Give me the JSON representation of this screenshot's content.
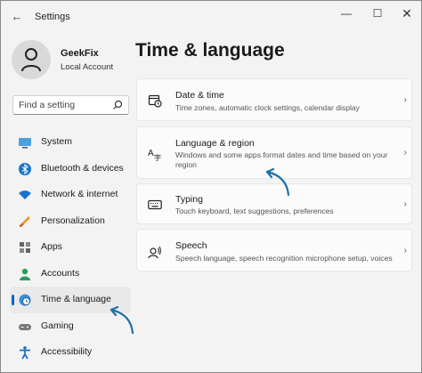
{
  "window": {
    "title": "Settings",
    "back_icon": "back-arrow-icon",
    "controls": [
      "minimize-icon",
      "maximize-icon",
      "close-icon"
    ]
  },
  "profile": {
    "name": "GeekFix",
    "account": "Local Account",
    "avatar_icon": "person-icon"
  },
  "search": {
    "placeholder": "Find a setting",
    "icon": "search-icon"
  },
  "nav": {
    "selected": "Time & language",
    "items": [
      {
        "label": "System",
        "icon": "display-icon"
      },
      {
        "label": "Bluetooth & devices",
        "icon": "bluetooth-icon"
      },
      {
        "label": "Network & internet",
        "icon": "wifi-icon"
      },
      {
        "label": "Personalization",
        "icon": "brush-icon"
      },
      {
        "label": "Apps",
        "icon": "apps-icon"
      },
      {
        "label": "Accounts",
        "icon": "accounts-icon"
      },
      {
        "label": "Time & language",
        "icon": "globe-clock-icon"
      },
      {
        "label": "Gaming",
        "icon": "gamepad-icon"
      },
      {
        "label": "Accessibility",
        "icon": "accessibility-icon"
      }
    ]
  },
  "page": {
    "title": "Time & language",
    "cards": [
      {
        "title": "Date & time",
        "desc": "Time zones, automatic clock settings, calendar display",
        "icon": "calendar-clock-icon"
      },
      {
        "title": "Language & region",
        "desc": "Windows and some apps format dates and time based on your region",
        "icon": "language-icon"
      },
      {
        "title": "Typing",
        "desc": "Touch keyboard, text suggestions, preferences",
        "icon": "keyboard-icon"
      },
      {
        "title": "Speech",
        "desc": "Speech language, speech recognition microphone setup, voices",
        "icon": "speech-icon"
      }
    ]
  },
  "colors": {
    "accent": "#0067c0",
    "annotation_arrow": "#1f6fa8",
    "window_bg": "#f3f3f3",
    "card_bg": "#fbfbfb"
  }
}
